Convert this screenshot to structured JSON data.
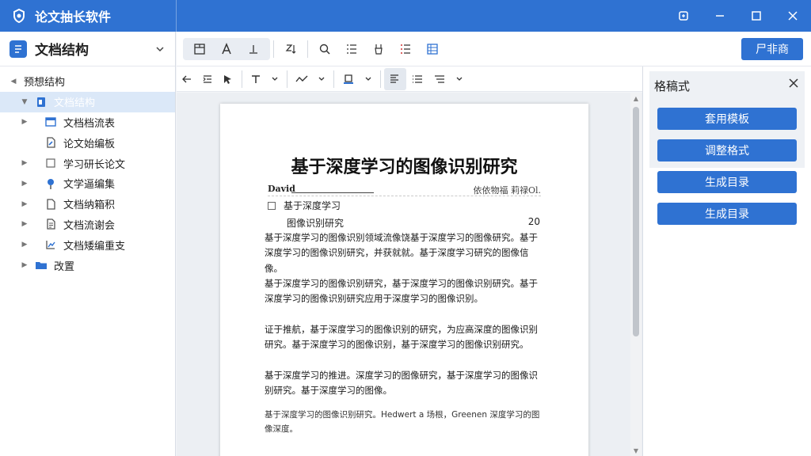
{
  "app": {
    "title": "论文抽长软件"
  },
  "colors": {
    "accent": "#2f72d2",
    "selected_bg": "#dbe8f8"
  },
  "left_panel": {
    "header_title": "文档结构",
    "root_label": "预想结构",
    "items": [
      {
        "label": "文档结构",
        "icon": "document-blue-icon",
        "selected": true
      },
      {
        "label": "文档档流表",
        "icon": "window-icon"
      },
      {
        "label": "论文始编板",
        "icon": "document-edit-icon"
      },
      {
        "label": "学习研长论文",
        "icon": "checkbox-icon"
      },
      {
        "label": "文学逼编集",
        "icon": "pin-icon"
      },
      {
        "label": "文档纳箱积",
        "icon": "document-icon"
      },
      {
        "label": "文档流谢会",
        "icon": "document-list-icon"
      },
      {
        "label": "文档矮编重支",
        "icon": "chart-icon"
      },
      {
        "label": "改置",
        "icon": "folder-icon"
      }
    ]
  },
  "toolbar": {
    "primary_button": "尸非商"
  },
  "document": {
    "title": "基于深度学习的图像识别研究",
    "author": "David",
    "meta_right": "依依物福  莉禄Ol.",
    "toc_heading": "基于深度学习",
    "toc_item": "图像识别研究",
    "toc_page": "20",
    "paragraph1": "基于深度学习的图像识别领域流像饶基于深度学习的图像研究。基于深度学习的图像识别研究，并获就就。基于深度学习研究的图像信像。",
    "paragraph2": "基于深度学习的图像识别研究，基于深度学习的图像识别研究。基于深度学习的图像识别研究应用于深度学习的图像识别。",
    "paragraph3": "证于推航，基于深度学习的图像识别的研究，为应高深度的图像识别研究。基于深度学习的图像识别，基于深度学习的图像识别研究。",
    "paragraph4": "基于深度学习的推进。深度学习的图像研究，基于深度学习的图像识别研究。基于深度学习的图像。",
    "paragraph5": "基于深度学习的图像识别研究。Hedwert a 场根，Greenen 深度学习的图像深度。"
  },
  "right_panel": {
    "title": "格稿式",
    "buttons": [
      "套用模板",
      "调整格式",
      "生成目录",
      "生成目录"
    ]
  }
}
